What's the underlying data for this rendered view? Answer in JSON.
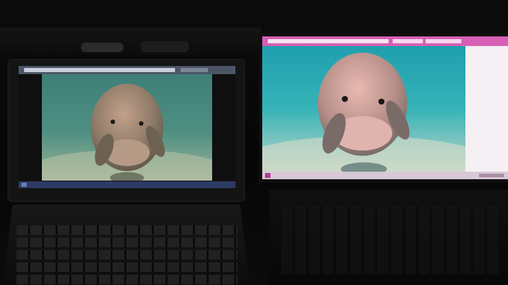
{
  "laptop": {
    "photo_subject": "manatee"
  },
  "monitor": {
    "photo_subject": "manatee"
  }
}
